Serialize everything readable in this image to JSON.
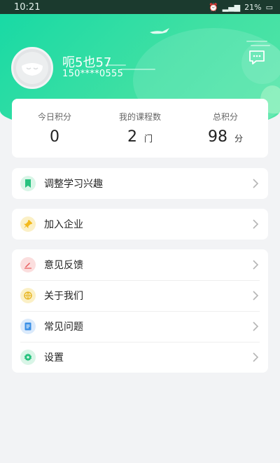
{
  "status_bar": {
    "time": "10:21",
    "battery": "21%"
  },
  "profile": {
    "name": "呃5也57",
    "phone": "150****0555"
  },
  "stats": [
    {
      "label": "今日积分",
      "value": "0",
      "unit": ""
    },
    {
      "label": "我的课程数",
      "value": "2",
      "unit": "门"
    },
    {
      "label": "总积分",
      "value": "98",
      "unit": "分"
    }
  ],
  "menu": {
    "interest": {
      "label": "调整学习兴趣",
      "icon": "bookmark-icon",
      "color": "#27c27e"
    },
    "company": {
      "label": "加入企业",
      "icon": "pin-icon",
      "color": "#f3b91d"
    },
    "feedback": {
      "label": "意见反馈",
      "icon": "pen-icon",
      "color": "#e85a5a"
    },
    "about": {
      "label": "关于我们",
      "icon": "globe-icon",
      "color": "#e6b21a"
    },
    "faq": {
      "label": "常见问题",
      "icon": "document-icon",
      "color": "#3a8fe6"
    },
    "settings": {
      "label": "设置",
      "icon": "gear-icon",
      "color": "#27c27e"
    }
  },
  "colors": {
    "accent": "#22dc9f",
    "background": "#f2f3f5"
  }
}
